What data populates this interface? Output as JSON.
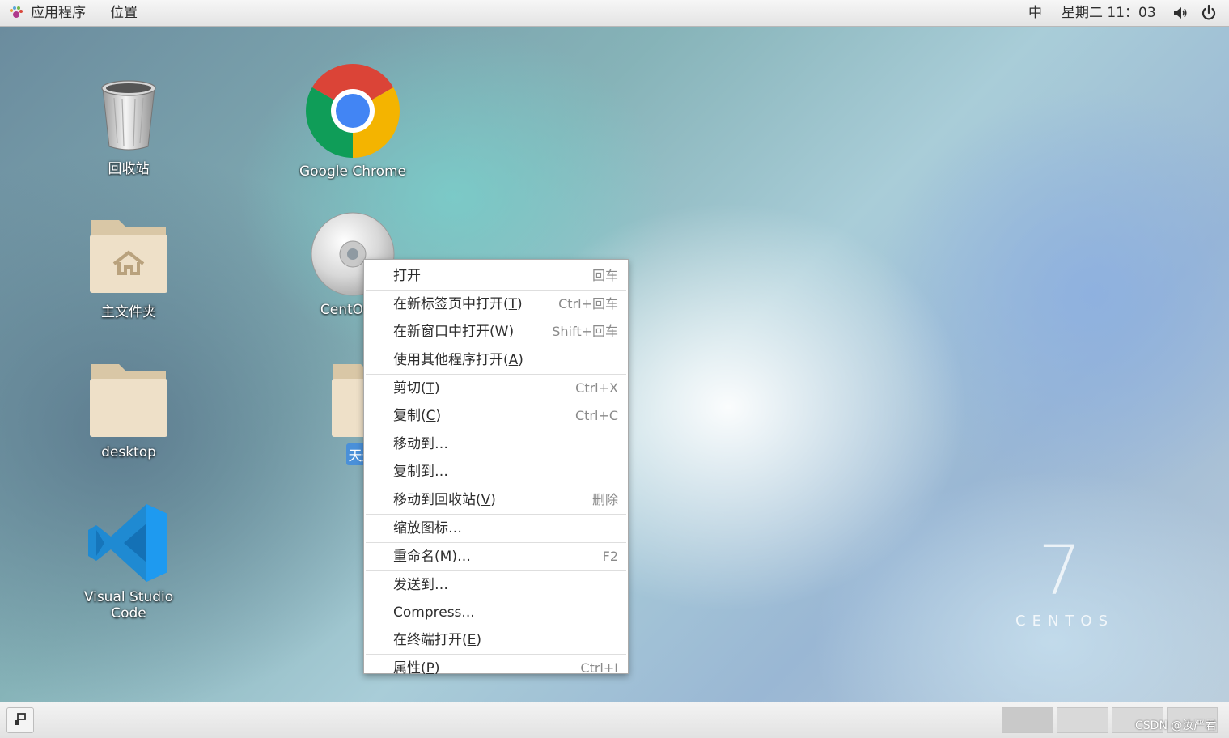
{
  "top_panel": {
    "applications": "应用程序",
    "places": "位置",
    "input_method": "中",
    "clock": "星期二 11：03"
  },
  "desktop_icons": {
    "trash": "回收站",
    "chrome": "Google Chrome",
    "home": "主文件夹",
    "centos": "CentOS 7",
    "desktop_folder": "desktop",
    "selected_folder": "天天生",
    "vscode": "Visual Studio Code"
  },
  "context_menu": {
    "open": {
      "label": "打开",
      "accel": "回车"
    },
    "open_tab": {
      "label": "在新标签页中打开(",
      "key": "T",
      "tail": ")",
      "accel": "Ctrl+回车"
    },
    "open_window": {
      "label": "在新窗口中打开(",
      "key": "W",
      "tail": ")",
      "accel": "Shift+回车"
    },
    "open_with": {
      "label": "使用其他程序打开(",
      "key": "A",
      "tail": ")"
    },
    "cut": {
      "label": "剪切(",
      "key": "T",
      "tail": ")",
      "accel": "Ctrl+X"
    },
    "copy": {
      "label": "复制(",
      "key": "C",
      "tail": ")",
      "accel": "Ctrl+C"
    },
    "move_to": {
      "label": "移动到…"
    },
    "copy_to": {
      "label": "复制到…"
    },
    "trash": {
      "label": "移动到回收站(",
      "key": "V",
      "tail": ")",
      "accel": "删除"
    },
    "zoom": {
      "label": "缩放图标…"
    },
    "rename": {
      "label": "重命名(",
      "key": "M",
      "tail": ")…",
      "accel": "F2"
    },
    "send_to": {
      "label": "发送到…"
    },
    "compress": {
      "label": "Compress..."
    },
    "terminal": {
      "label": "在终端打开(",
      "key": "E",
      "tail": ")"
    },
    "properties": {
      "label": "属性(",
      "key": "P",
      "tail": ")",
      "accel": "Ctrl+I"
    }
  },
  "branding": {
    "version": "7",
    "distro": "CENTOS"
  },
  "watermark": "CSDN @汝严君"
}
